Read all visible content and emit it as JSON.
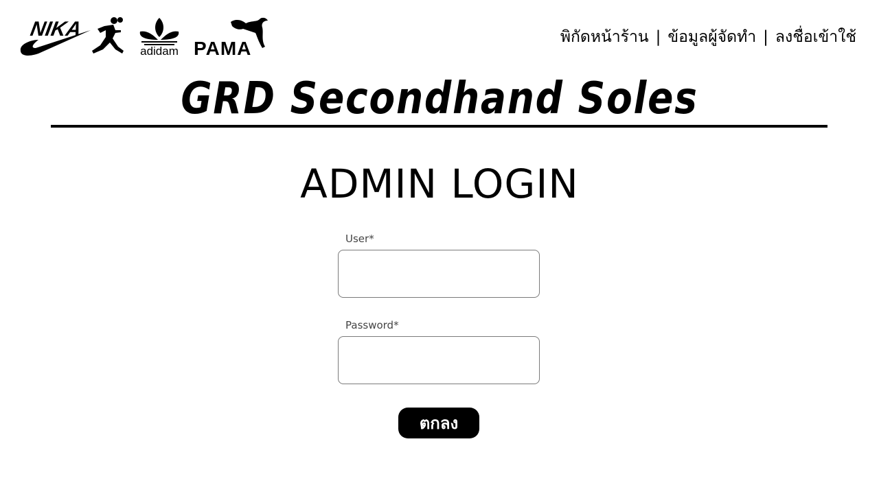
{
  "logos": {
    "nika": "NIKA",
    "adidam": "adidam",
    "pama": "PAMA"
  },
  "nav": {
    "items": [
      {
        "label": "พิกัดหน้าร้าน"
      },
      {
        "label": "ข้อมูลผู้จัดทำ"
      },
      {
        "label": "ลงชื่อเข้าใช้"
      }
    ],
    "separator": "|"
  },
  "brand": {
    "title": "GRD Secondhand Soles"
  },
  "login": {
    "heading": "ADMIN LOGIN",
    "user_label": "User*",
    "user_value": "",
    "password_label": "Password*",
    "password_value": "",
    "submit_label": "ตกลง"
  },
  "colors": {
    "text": "#000000",
    "background": "#ffffff",
    "button_bg": "#000000",
    "button_text": "#ffffff",
    "input_border": "#7a7a7a",
    "label_text": "#444444"
  },
  "icons": [
    "swoosh-icon",
    "jumpman-icon",
    "trefoil-icon",
    "puma-cat-icon"
  ]
}
